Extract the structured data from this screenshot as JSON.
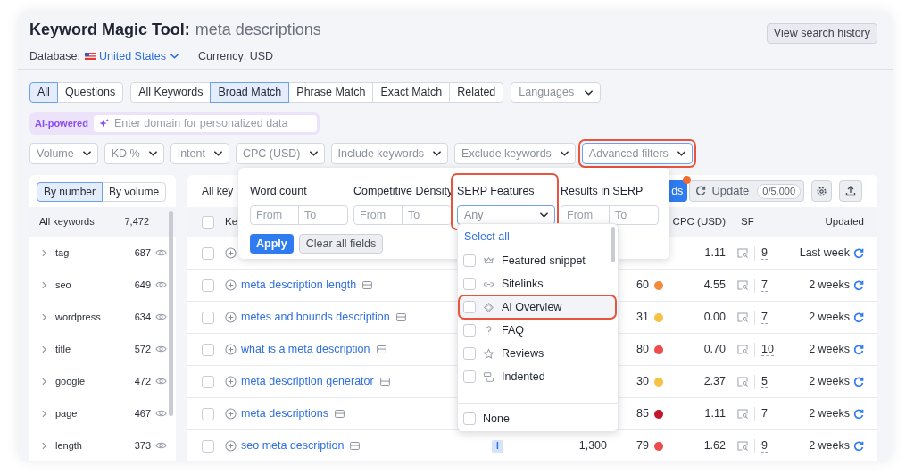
{
  "header": {
    "title": "Keyword Magic Tool:",
    "query": "meta descriptions",
    "history_button": "View search history",
    "database_label": "Database:",
    "database": "United States",
    "currency": "Currency: USD"
  },
  "tab_groups": [
    [
      {
        "label": "All",
        "selected": true
      },
      {
        "label": "Questions",
        "selected": false
      }
    ],
    [
      {
        "label": "All Keywords",
        "selected": false
      },
      {
        "label": "Broad Match",
        "selected": true
      },
      {
        "label": "Phrase Match",
        "selected": false
      },
      {
        "label": "Exact Match",
        "selected": false
      },
      {
        "label": "Related",
        "selected": false
      }
    ]
  ],
  "languages": "Languages",
  "ai": {
    "badge": "AI-powered",
    "placeholder": "Enter domain for personalized data"
  },
  "filters": [
    {
      "label": "Volume",
      "open": false,
      "highlighted": false
    },
    {
      "label": "KD %",
      "open": false,
      "highlighted": false
    },
    {
      "label": "Intent",
      "open": false,
      "highlighted": false
    },
    {
      "label": "CPC (USD)",
      "open": false,
      "highlighted": false
    },
    {
      "label": "Include keywords",
      "open": false,
      "highlighted": false
    },
    {
      "label": "Exclude keywords",
      "open": false,
      "highlighted": false
    },
    {
      "label": "Advanced filters",
      "open": true,
      "highlighted": true
    }
  ],
  "sidebar": {
    "toggle": [
      {
        "label": "By number",
        "selected": true
      },
      {
        "label": "By volume",
        "selected": false
      }
    ],
    "all": {
      "label": "All keywords",
      "count": "7,472"
    },
    "groups": [
      {
        "label": "tag",
        "count": "687"
      },
      {
        "label": "seo",
        "count": "649"
      },
      {
        "label": "wordpress",
        "count": "634"
      },
      {
        "label": "title",
        "count": "572"
      },
      {
        "label": "google",
        "count": "472"
      },
      {
        "label": "page",
        "count": "467"
      },
      {
        "label": "length",
        "count": "373"
      }
    ]
  },
  "table": {
    "title": "All key",
    "all_checked": false,
    "add_button": "ds",
    "update_button": "Update",
    "update_count": "0/5,000",
    "columns": [
      {
        "kind": "keyword",
        "label": "Ke"
      },
      {
        "kind": "cpc",
        "label": "CPC (USD)"
      },
      {
        "kind": "sf",
        "label": "SF"
      },
      {
        "kind": "updated",
        "label": "Updated"
      }
    ],
    "rows": [
      {
        "checked": false,
        "cpc": "1.11",
        "sf": "9",
        "updated": "Last week"
      },
      {
        "checked": false,
        "keyword": "meta description length",
        "kd": "60",
        "color": "#f28a3c",
        "cpc": "4.55",
        "sf": "7",
        "updated": "2 weeks"
      },
      {
        "checked": false,
        "keyword": "metes and bounds description",
        "kd": "31",
        "color": "#f5c343",
        "cpc": "0.00",
        "sf": "7",
        "updated": "2 weeks"
      },
      {
        "checked": false,
        "keyword": "what is a meta description",
        "kd": "80",
        "color": "#ee4b4b",
        "cpc": "0.70",
        "sf": "10",
        "updated": "2 weeks"
      },
      {
        "checked": false,
        "keyword": "meta description generator",
        "kd": "30",
        "color": "#f5c343",
        "cpc": "2.37",
        "sf": "5",
        "updated": "2 weeks"
      },
      {
        "checked": false,
        "keyword": "meta descriptions",
        "kd": "85",
        "color": "#c4162a",
        "cpc": "1.11",
        "sf": "7",
        "updated": "2 weeks"
      },
      {
        "checked": false,
        "keyword": "seo meta description",
        "intent": "I",
        "volume": "1,300",
        "kd": "79",
        "color": "#ee4b4b",
        "cpc": "1.62",
        "sf": "9",
        "updated": "2 weeks"
      }
    ]
  },
  "advanced_filters": {
    "fields": [
      {
        "label": "Word count",
        "kind": "range",
        "from": {
          "placeholder": "From"
        },
        "to": {
          "placeholder": "To"
        },
        "highlighted": false
      },
      {
        "label": "Competitive Density",
        "kind": "range",
        "from": {
          "placeholder": "From"
        },
        "to": {
          "placeholder": "To"
        },
        "highlighted": false
      },
      {
        "label": "SERP Features",
        "kind": "select",
        "value": "Any",
        "highlighted": true
      },
      {
        "label": "Results in SERP",
        "kind": "range",
        "from": {
          "placeholder": "From"
        },
        "to": {
          "placeholder": "To"
        },
        "highlighted": false
      }
    ],
    "apply": "Apply",
    "clear": "Clear all fields"
  },
  "serp_dropdown": {
    "select_all": "Select all",
    "options": [
      {
        "label": "Featured snippet",
        "checked": false,
        "highlighted": false
      },
      {
        "label": "Sitelinks",
        "checked": false,
        "highlighted": false
      },
      {
        "label": "AI Overview",
        "checked": false,
        "highlighted": true
      },
      {
        "label": "FAQ",
        "checked": false,
        "highlighted": false
      },
      {
        "label": "Reviews",
        "checked": false,
        "highlighted": false
      },
      {
        "label": "Indented",
        "checked": false,
        "highlighted": false
      }
    ],
    "none": {
      "label": "None",
      "checked": false
    }
  }
}
